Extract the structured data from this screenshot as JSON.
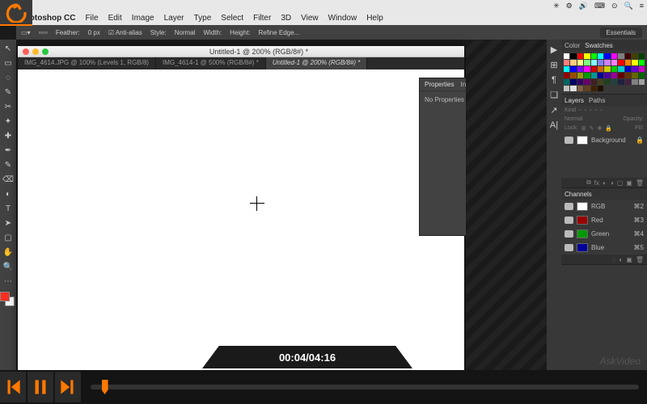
{
  "back_icon": "back",
  "mac_menu_right": [
    "✳",
    "⚙",
    "🔊",
    "⌨",
    "⊙",
    "🔍",
    "≡"
  ],
  "app": {
    "name": "Photoshop CC",
    "menus": [
      "File",
      "Edit",
      "Image",
      "Layer",
      "Type",
      "Select",
      "Filter",
      "3D",
      "View",
      "Window",
      "Help"
    ]
  },
  "options": {
    "feather_label": "Feather:",
    "feather_value": "0 px",
    "antialias": "Anti-alias",
    "style_label": "Style:",
    "style_value": "Normal",
    "width_label": "Width:",
    "height_label": "Height:",
    "refine": "Refine Edge...",
    "workspace_label": "Essentials"
  },
  "tools_glyphs": [
    "↖",
    "▭",
    "◌",
    "✎",
    "✂",
    "✦",
    "✚",
    "✒",
    "✎",
    "⌫",
    "◐",
    "T",
    "➤",
    "▢",
    "✋",
    "🔍",
    "⋯"
  ],
  "doc": {
    "window_title": "Untitled-1 @ 200% (RGB/8#) *",
    "tabs": [
      {
        "label": "IMG_4614.JPG @ 100% (Levels 1, RGB/8)",
        "active": false
      },
      {
        "label": "IMG_4614-1 @ 500% (RGB/8#) *",
        "active": false
      },
      {
        "label": "Untitled-1 @ 200% (RGB/8#) *",
        "active": true
      }
    ]
  },
  "float_panel": {
    "tabs": [
      "Properties",
      "Info"
    ],
    "body": "No Properties"
  },
  "iconcol": [
    "▶",
    "⊞",
    "¶",
    "❏",
    "↗",
    "A|"
  ],
  "color_panel": {
    "tabs": [
      "Color",
      "Swatches"
    ]
  },
  "swatch_colors": [
    "#fff",
    "#000",
    "#ff0000",
    "#ffff00",
    "#00ff00",
    "#00ffff",
    "#0000ff",
    "#ff00ff",
    "#808080",
    "#400000",
    "#404000",
    "#004000",
    "#ff8080",
    "#ffcc80",
    "#ffff80",
    "#80ff80",
    "#80ffff",
    "#8080ff",
    "#cc80ff",
    "#ff80ff",
    "#ff0000",
    "#ff8000",
    "#ffff00",
    "#00ff00",
    "#00ffff",
    "#0000ff",
    "#8000ff",
    "#ff00ff",
    "#cc0000",
    "#cc6600",
    "#cccc00",
    "#00cc00",
    "#00cccc",
    "#0000cc",
    "#6600cc",
    "#cc00cc",
    "#990000",
    "#994c00",
    "#999900",
    "#009900",
    "#009999",
    "#000099",
    "#4c0099",
    "#990099",
    "#660000",
    "#663300",
    "#666600",
    "#006600",
    "#006666",
    "#000066",
    "#330066",
    "#660066",
    "#402020",
    "#404020",
    "#204020",
    "#204040",
    "#202040",
    "#402040",
    "#808080",
    "#a0a0a0",
    "#c0c0c0",
    "#e0e0e0",
    "#806040",
    "#604020",
    "#402000",
    "#201000"
  ],
  "layers_panel": {
    "tabs": [
      "Layers",
      "Paths"
    ],
    "kind": "Kind",
    "mode_label": "Normal",
    "opacity_label": "Opacity:",
    "lock_label": "Lock:",
    "fill_label": "Fill:",
    "items": [
      {
        "name": "Background",
        "locked": true
      }
    ]
  },
  "channels_panel": {
    "tabs": [
      "Channels"
    ],
    "items": [
      {
        "name": "RGB",
        "key": "⌘2"
      },
      {
        "name": "Red",
        "key": "⌘3"
      },
      {
        "name": "Green",
        "key": "⌘4"
      },
      {
        "name": "Blue",
        "key": "⌘5"
      }
    ]
  },
  "timecode": "00:04/04:16",
  "watermark": "AskVideo"
}
